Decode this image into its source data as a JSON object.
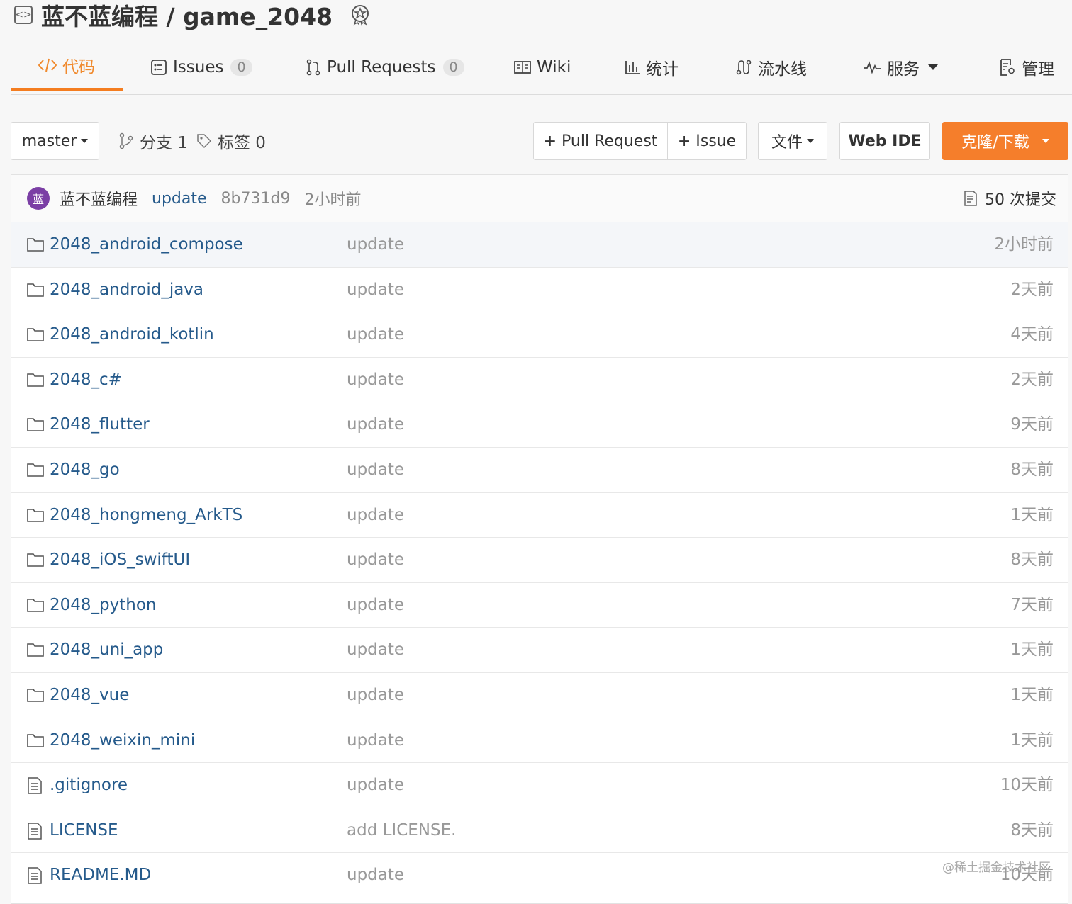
{
  "repo": {
    "title": "蓝不蓝编程 / game_2048"
  },
  "tabs": [
    {
      "label": "代码",
      "icon": "code-icon"
    },
    {
      "label": "Issues",
      "count": "0",
      "icon": "issues-icon"
    },
    {
      "label": "Pull Requests",
      "count": "0",
      "icon": "pull-request-icon"
    },
    {
      "label": "Wiki",
      "icon": "wiki-icon"
    },
    {
      "label": "统计",
      "icon": "stats-icon"
    },
    {
      "label": "流水线",
      "icon": "pipeline-icon"
    },
    {
      "label": "服务",
      "icon": "service-icon"
    },
    {
      "label": "管理",
      "icon": "manage-icon"
    }
  ],
  "toolbar": {
    "branch": "master",
    "branches": "分支 1",
    "tags": "标签 0",
    "pull_request": "+ Pull Request",
    "issue": "+ Issue",
    "file": "文件",
    "web_ide": "Web IDE",
    "clone": "克隆/下载"
  },
  "commit": {
    "avatar": "蓝",
    "author": "蓝不蓝编程",
    "message": "update",
    "sha": "8b731d9",
    "time": "2小时前",
    "count": "50 次提交"
  },
  "files": [
    {
      "name": "2048_android_compose",
      "type": "folder",
      "message": "update",
      "time": "2小时前"
    },
    {
      "name": "2048_android_java",
      "type": "folder",
      "message": "update",
      "time": "2天前"
    },
    {
      "name": "2048_android_kotlin",
      "type": "folder",
      "message": "update",
      "time": "4天前"
    },
    {
      "name": "2048_c#",
      "type": "folder",
      "message": "update",
      "time": "2天前"
    },
    {
      "name": "2048_flutter",
      "type": "folder",
      "message": "update",
      "time": "9天前"
    },
    {
      "name": "2048_go",
      "type": "folder",
      "message": "update",
      "time": "8天前"
    },
    {
      "name": "2048_hongmeng_ArkTS",
      "type": "folder",
      "message": "update",
      "time": "1天前"
    },
    {
      "name": "2048_iOS_swiftUI",
      "type": "folder",
      "message": "update",
      "time": "8天前"
    },
    {
      "name": "2048_python",
      "type": "folder",
      "message": "update",
      "time": "7天前"
    },
    {
      "name": "2048_uni_app",
      "type": "folder",
      "message": "update",
      "time": "1天前"
    },
    {
      "name": "2048_vue",
      "type": "folder",
      "message": "update",
      "time": "1天前"
    },
    {
      "name": "2048_weixin_mini",
      "type": "folder",
      "message": "update",
      "time": "1天前"
    },
    {
      "name": ".gitignore",
      "type": "file",
      "message": "update",
      "time": "10天前"
    },
    {
      "name": "LICENSE",
      "type": "file",
      "message": "add LICENSE.",
      "time": "8天前"
    },
    {
      "name": "README.MD",
      "type": "file",
      "message": "update",
      "time": "10天前"
    }
  ],
  "watermark": "@稀土掘金技术社区",
  "colors": {
    "accent": "#f57e2b",
    "link": "#255a8b",
    "muted": "#999999"
  }
}
